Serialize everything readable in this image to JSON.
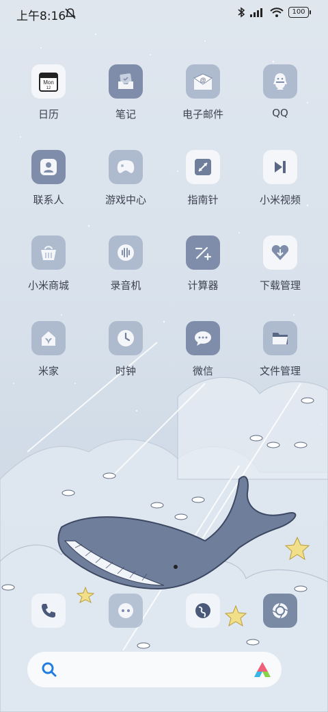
{
  "status": {
    "time": "上午8:16",
    "battery": "100",
    "icons": [
      "bell-muted-icon",
      "bluetooth-icon",
      "signal-icon",
      "wifi-icon",
      "battery-icon"
    ]
  },
  "apps": [
    {
      "label": "日历",
      "icon": "calendar-icon",
      "month": "Mon",
      "day": "12"
    },
    {
      "label": "笔记",
      "icon": "notes-icon"
    },
    {
      "label": "电子邮件",
      "icon": "email-icon"
    },
    {
      "label": "QQ",
      "icon": "qq-icon"
    },
    {
      "label": "联系人",
      "icon": "contacts-icon"
    },
    {
      "label": "游戏中心",
      "icon": "game-center-icon"
    },
    {
      "label": "指南针",
      "icon": "compass-icon"
    },
    {
      "label": "小米视频",
      "icon": "video-icon"
    },
    {
      "label": "小米商城",
      "icon": "store-icon"
    },
    {
      "label": "录音机",
      "icon": "recorder-icon"
    },
    {
      "label": "计算器",
      "icon": "calculator-icon"
    },
    {
      "label": "下载管理",
      "icon": "download-icon"
    },
    {
      "label": "米家",
      "icon": "mi-home-icon"
    },
    {
      "label": "时钟",
      "icon": "clock-icon"
    },
    {
      "label": "微信",
      "icon": "wechat-icon"
    },
    {
      "label": "文件管理",
      "icon": "file-manager-icon"
    }
  ],
  "dock": [
    "phone-icon",
    "messages-icon",
    "browser-icon",
    "camera-icon"
  ],
  "search": {
    "icons": [
      "search-icon",
      "assistant-icon"
    ]
  }
}
